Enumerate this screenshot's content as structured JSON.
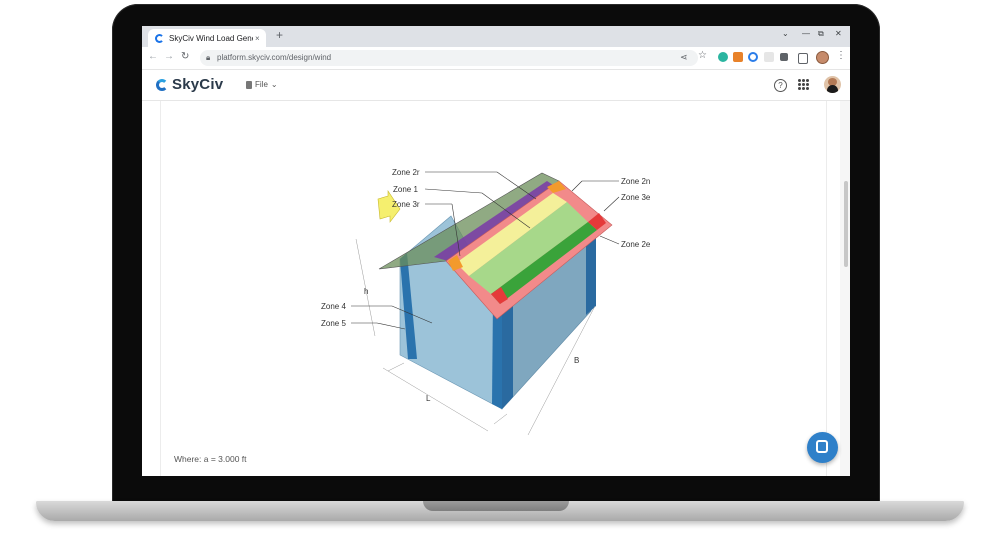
{
  "browser": {
    "tab_title": "SkyCiv Wind Load Genera",
    "tab_close": "×",
    "new_tab": "+",
    "url": "platform.skyciv.com/design/wind",
    "win_minimize": "—",
    "win_restore": "⧉",
    "win_close": "✕",
    "win_dropdown": "⌄"
  },
  "app": {
    "brand": "SkyCiv",
    "file_menu": "File",
    "help": "?"
  },
  "diagram": {
    "zones": {
      "zone_2r": "Zone 2r",
      "zone_1": "Zone 1",
      "zone_3r": "Zone 3r",
      "zone_2n": "Zone 2n",
      "zone_3e": "Zone 3e",
      "zone_2e": "Zone 2e",
      "zone_4": "Zone 4",
      "zone_5": "Zone 5"
    },
    "dims": {
      "h": "h",
      "l": "L",
      "b": "B",
      "a": "a"
    }
  },
  "footnote": "Where: a = 3.000 ft",
  "colors": {
    "roof_edge": "#f28a8a",
    "zone1": "#a7d88a",
    "zone2": "#3aa33a",
    "zone3_purple": "#7a3aa8",
    "zone_yellow": "#f4f09a",
    "zone_orange": "#f39a2c",
    "zone_red": "#e53a3a",
    "wall": "#9cc3d9",
    "wall_dark": "#2a73ad",
    "arrow": "#f5ef6e"
  }
}
